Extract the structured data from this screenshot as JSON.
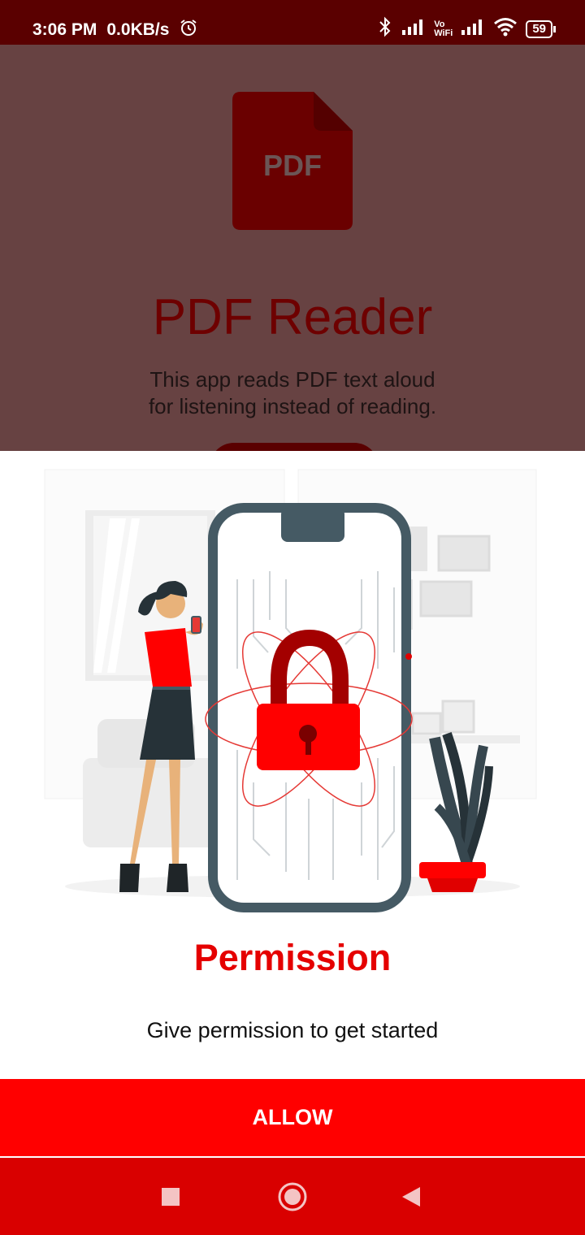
{
  "status": {
    "time": "3:06 PM",
    "speed": "0.0KB/s",
    "battery": "59",
    "vowifi_top": "Vo",
    "vowifi_bottom": "WiFi"
  },
  "background": {
    "pdf_icon_text": "PDF",
    "title": "PDF Reader",
    "description": "This app reads PDF text aloud\n for listening instead of reading."
  },
  "sheet": {
    "title": "Permission",
    "description": "Give permission to get started",
    "allow_label": "ALLOW"
  },
  "nav": {
    "icons": [
      "recents-square-icon",
      "home-circle-icon",
      "back-triangle-icon"
    ]
  },
  "colors": {
    "accent": "#ff0000",
    "title_red": "#e50000",
    "status_bar": "#5a0000",
    "nav_bar": "#d90000",
    "dim_background": "#674242"
  }
}
